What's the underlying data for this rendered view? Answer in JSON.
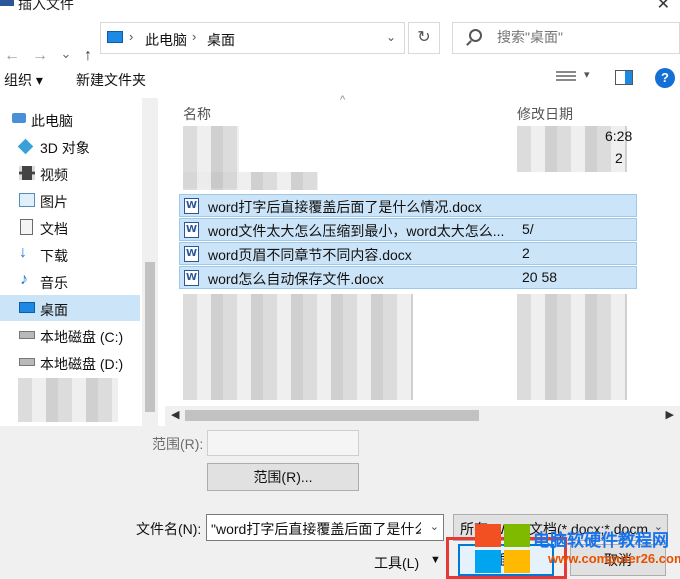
{
  "window": {
    "title": "插入文件",
    "close_glyph": "✕"
  },
  "nav": {
    "back_glyph": "←",
    "forward_glyph": "→",
    "recent_glyph": "⌄",
    "up_glyph": "↑",
    "address": [
      "此电脑",
      "桌面"
    ],
    "address_sep": "›",
    "refresh_glyph": "↻",
    "search_placeholder": "搜索\"桌面\""
  },
  "toolbar": {
    "organize": "组织 ▾",
    "new_folder": "新建文件夹",
    "help": "?"
  },
  "sidebar": {
    "items": [
      {
        "label": "此电脑",
        "icon": "computer-icon"
      },
      {
        "label": "3D 对象",
        "icon": "3d-objects-icon"
      },
      {
        "label": "视频",
        "icon": "video-icon"
      },
      {
        "label": "图片",
        "icon": "picture-icon"
      },
      {
        "label": "文档",
        "icon": "document-icon"
      },
      {
        "label": "下载",
        "icon": "download-icon"
      },
      {
        "label": "音乐",
        "icon": "music-icon"
      },
      {
        "label": "桌面",
        "icon": "desktop-icon",
        "active": true
      },
      {
        "label": "本地磁盘 (C:)",
        "icon": "drive-icon"
      },
      {
        "label": "本地磁盘 (D:)",
        "icon": "drive-icon"
      }
    ]
  },
  "files": {
    "col_name": "名称",
    "col_date": "修改日期",
    "partial_dates": [
      "6:28",
      "2"
    ],
    "rows": [
      {
        "name": "word打字后直接覆盖后面了是什么情况.docx",
        "date": ""
      },
      {
        "name": "word文件太大怎么压缩到最小，word太大怎么...",
        "date": "5/"
      },
      {
        "name": "word页眉不同章节不同内容.docx",
        "date": "2"
      },
      {
        "name": "word怎么自动保存文件.docx",
        "date": "20 58"
      }
    ]
  },
  "bottom": {
    "range_label": "范围(R):",
    "range_button": "范围(R)...",
    "filename_label": "文件名(N):",
    "filename_value": "\"word打字后直接覆盖后面了是什么",
    "filetype_value": "所有 Word 文档(*.docx;*.docm",
    "tools": "工具(L)",
    "insert": "插入",
    "cancel": "取消"
  },
  "watermark": {
    "title": "电脑软硬件教程网",
    "url": "www.computer26.com"
  },
  "colors": {
    "selection": "#cce4f7",
    "accent": "#0078d7",
    "highlight_frame": "#e53935"
  }
}
